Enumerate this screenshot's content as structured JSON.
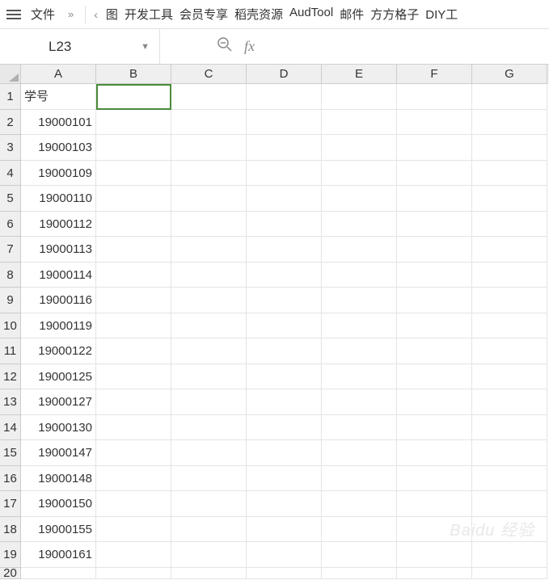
{
  "menubar": {
    "file": "文件",
    "more": "»",
    "nav_prev": "‹",
    "tabs": [
      "图",
      "开发工具",
      "会员专享",
      "稻壳资源",
      "AudTool",
      "邮件",
      "方方格子",
      "DIY工"
    ]
  },
  "fxbar": {
    "namebox": "L23",
    "fx_label": "fx"
  },
  "columns": [
    "A",
    "B",
    "C",
    "D",
    "E",
    "F",
    "G"
  ],
  "rows": [
    {
      "n": "1",
      "a": "学号",
      "cls": "txt"
    },
    {
      "n": "2",
      "a": "19000101",
      "cls": "num"
    },
    {
      "n": "3",
      "a": "19000103",
      "cls": "num"
    },
    {
      "n": "4",
      "a": "19000109",
      "cls": "num"
    },
    {
      "n": "5",
      "a": "19000110",
      "cls": "num"
    },
    {
      "n": "6",
      "a": "19000112",
      "cls": "num"
    },
    {
      "n": "7",
      "a": "19000113",
      "cls": "num"
    },
    {
      "n": "8",
      "a": "19000114",
      "cls": "num"
    },
    {
      "n": "9",
      "a": "19000116",
      "cls": "num"
    },
    {
      "n": "10",
      "a": "19000119",
      "cls": "num"
    },
    {
      "n": "11",
      "a": "19000122",
      "cls": "num"
    },
    {
      "n": "12",
      "a": "19000125",
      "cls": "num"
    },
    {
      "n": "13",
      "a": "19000127",
      "cls": "num"
    },
    {
      "n": "14",
      "a": "19000130",
      "cls": "num"
    },
    {
      "n": "15",
      "a": "19000147",
      "cls": "num"
    },
    {
      "n": "16",
      "a": "19000148",
      "cls": "num"
    },
    {
      "n": "17",
      "a": "19000150",
      "cls": "num"
    },
    {
      "n": "18",
      "a": "19000155",
      "cls": "num"
    },
    {
      "n": "19",
      "a": "19000161",
      "cls": "num"
    },
    {
      "n": "20",
      "a": "",
      "cls": "num"
    }
  ],
  "watermark": "Baidu 经验"
}
